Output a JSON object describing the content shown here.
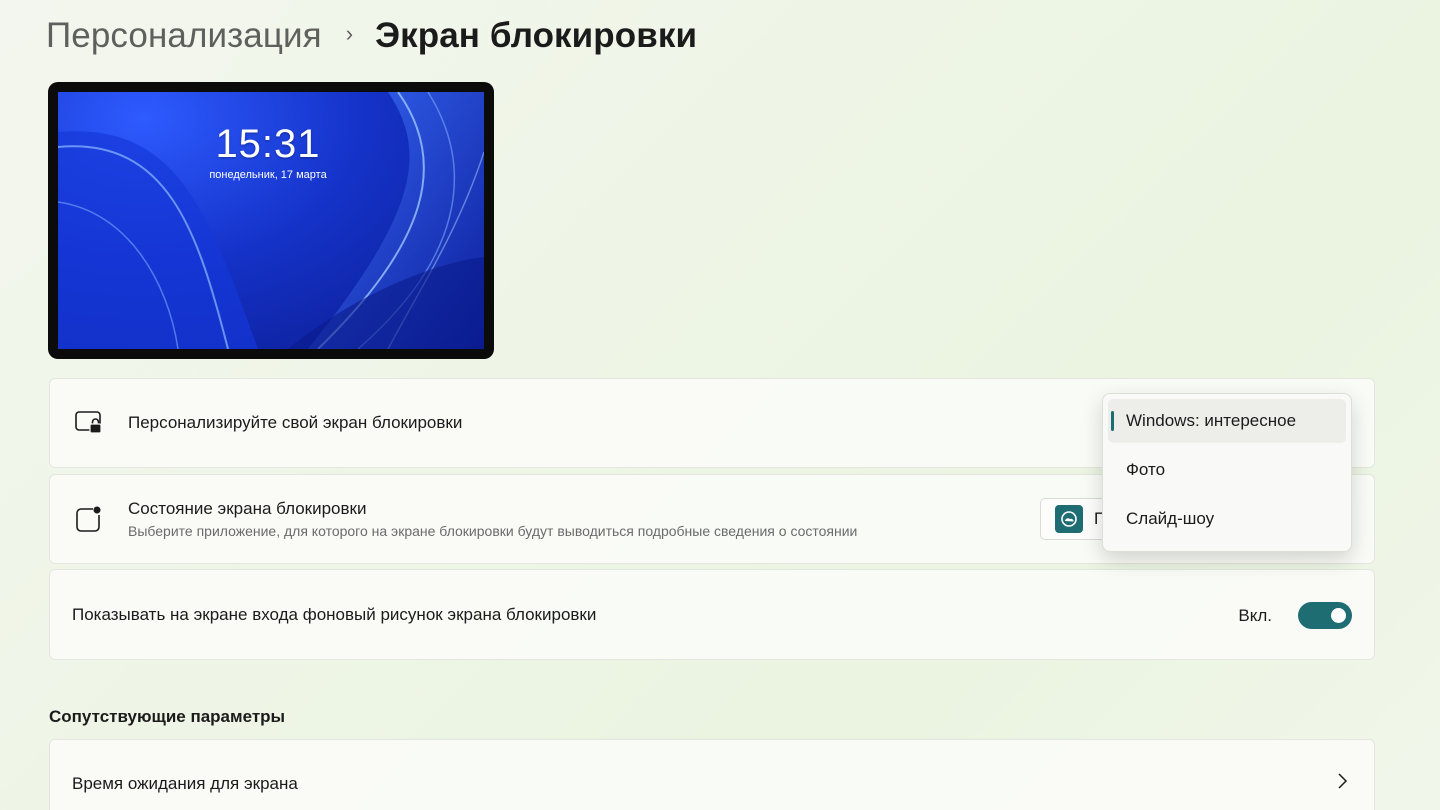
{
  "breadcrumb": {
    "parent": "Персонализация",
    "separator": "›",
    "current": "Экран блокировки"
  },
  "preview": {
    "time": "15:31",
    "date": "понедельник, 17 марта"
  },
  "personalize_row": {
    "title": "Персонализируйте свой экран блокировки",
    "icon": "lock-screen-icon"
  },
  "status_row": {
    "title": "Состояние экрана блокировки",
    "subtitle": "Выберите приложение, для которого на экране блокировки будут выводиться подробные сведения о состоянии",
    "icon": "lock-status-icon",
    "dropdown_text": "П",
    "app_icon": "weather-app-icon"
  },
  "signin_row": {
    "title": "Показывать на экране входа фоновый рисунок экрана блокировки",
    "toggle_label": "Вкл.",
    "toggle_on": true
  },
  "related": {
    "heading": "Сопутствующие параметры",
    "items": [
      {
        "label": "Время ожидания для экрана"
      }
    ]
  },
  "flyout": {
    "options": [
      {
        "label": "Windows: интересное",
        "selected": true
      },
      {
        "label": "Фото",
        "selected": false
      },
      {
        "label": "Слайд-шоу",
        "selected": false
      }
    ]
  },
  "colors": {
    "accent": "#1e6d73",
    "wallpaper": "#1533c9"
  }
}
